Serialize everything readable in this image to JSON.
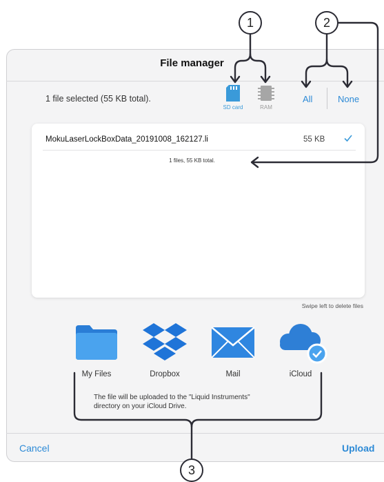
{
  "dialog": {
    "title": "File manager",
    "summary": "1 file selected (55 KB total).",
    "storage": [
      {
        "label": "SD card",
        "active": true,
        "icon": "sd-card-icon"
      },
      {
        "label": "RAM",
        "active": false,
        "icon": "ram-chip-icon"
      }
    ],
    "select_all": "All",
    "select_none": "None",
    "files": [
      {
        "name": "MokuLaserLockBoxData_20191008_162127.li",
        "size": "55 KB",
        "checked": true
      }
    ],
    "files_total": "1 files, 55 KB total.",
    "swipe_hint": "Swipe left to delete files"
  },
  "share": {
    "targets": [
      {
        "label": "My Files",
        "icon": "folder-icon"
      },
      {
        "label": "Dropbox",
        "icon": "dropbox-icon"
      },
      {
        "label": "Mail",
        "icon": "mail-icon"
      },
      {
        "label": "iCloud",
        "icon": "icloud-icon",
        "selected": true
      }
    ],
    "note": "The file will be uploaded to the \"Liquid Instruments\"\ndirectory on your iCloud Drive."
  },
  "footer": {
    "cancel": "Cancel",
    "upload": "Upload"
  },
  "callouts": [
    "1",
    "2",
    "3"
  ],
  "colors": {
    "accent": "#2d8ad6",
    "panel": "#f4f4f5",
    "annotation": "#2b2b34"
  }
}
